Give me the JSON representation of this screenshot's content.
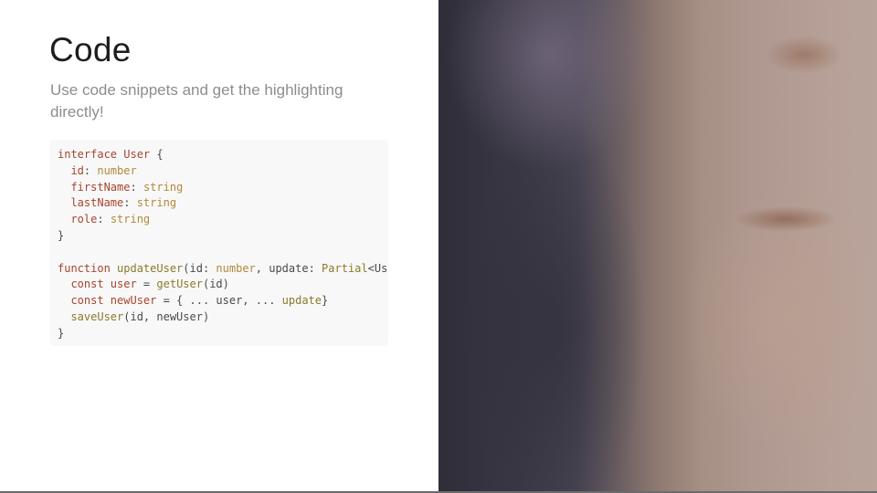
{
  "slide": {
    "title": "Code",
    "subtitle": "Use code snippets and get the highlighting directly!"
  },
  "code_block": {
    "language": "typescript",
    "lines": [
      [
        {
          "t": "interface ",
          "c": "kw"
        },
        {
          "t": "User",
          "c": "type"
        },
        {
          "t": " {",
          "c": "plain"
        }
      ],
      [
        {
          "t": "  id",
          "c": "prop"
        },
        {
          "t": ": ",
          "c": "plain"
        },
        {
          "t": "number",
          "c": "prim"
        }
      ],
      [
        {
          "t": "  firstName",
          "c": "prop"
        },
        {
          "t": ": ",
          "c": "plain"
        },
        {
          "t": "string",
          "c": "prim"
        }
      ],
      [
        {
          "t": "  lastName",
          "c": "prop"
        },
        {
          "t": ": ",
          "c": "plain"
        },
        {
          "t": "string",
          "c": "prim"
        }
      ],
      [
        {
          "t": "  role",
          "c": "prop"
        },
        {
          "t": ": ",
          "c": "plain"
        },
        {
          "t": "string",
          "c": "prim"
        }
      ],
      [
        {
          "t": "}",
          "c": "plain"
        }
      ],
      [
        {
          "t": "",
          "c": "plain"
        }
      ],
      [
        {
          "t": "function ",
          "c": "kw"
        },
        {
          "t": "updateUser",
          "c": "fn"
        },
        {
          "t": "(",
          "c": "plain"
        },
        {
          "t": "id",
          "c": "plain"
        },
        {
          "t": ": ",
          "c": "plain"
        },
        {
          "t": "number",
          "c": "prim"
        },
        {
          "t": ", ",
          "c": "plain"
        },
        {
          "t": "update",
          "c": "plain"
        },
        {
          "t": ": ",
          "c": "plain"
        },
        {
          "t": "Partial",
          "c": "fn"
        },
        {
          "t": "<User>) {",
          "c": "plain"
        }
      ],
      [
        {
          "t": "  const ",
          "c": "kw"
        },
        {
          "t": "user",
          "c": "prop"
        },
        {
          "t": " = ",
          "c": "plain"
        },
        {
          "t": "getUser",
          "c": "fn"
        },
        {
          "t": "(id)",
          "c": "plain"
        }
      ],
      [
        {
          "t": "  const ",
          "c": "kw"
        },
        {
          "t": "newUser",
          "c": "prop"
        },
        {
          "t": " = { ... user, ... ",
          "c": "plain"
        },
        {
          "t": "update",
          "c": "fn"
        },
        {
          "t": "}",
          "c": "plain"
        }
      ],
      [
        {
          "t": "  saveUser",
          "c": "fn"
        },
        {
          "t": "(id, newUser)",
          "c": "plain"
        }
      ],
      [
        {
          "t": "}",
          "c": "plain"
        }
      ]
    ]
  },
  "image": {
    "alt": ""
  }
}
